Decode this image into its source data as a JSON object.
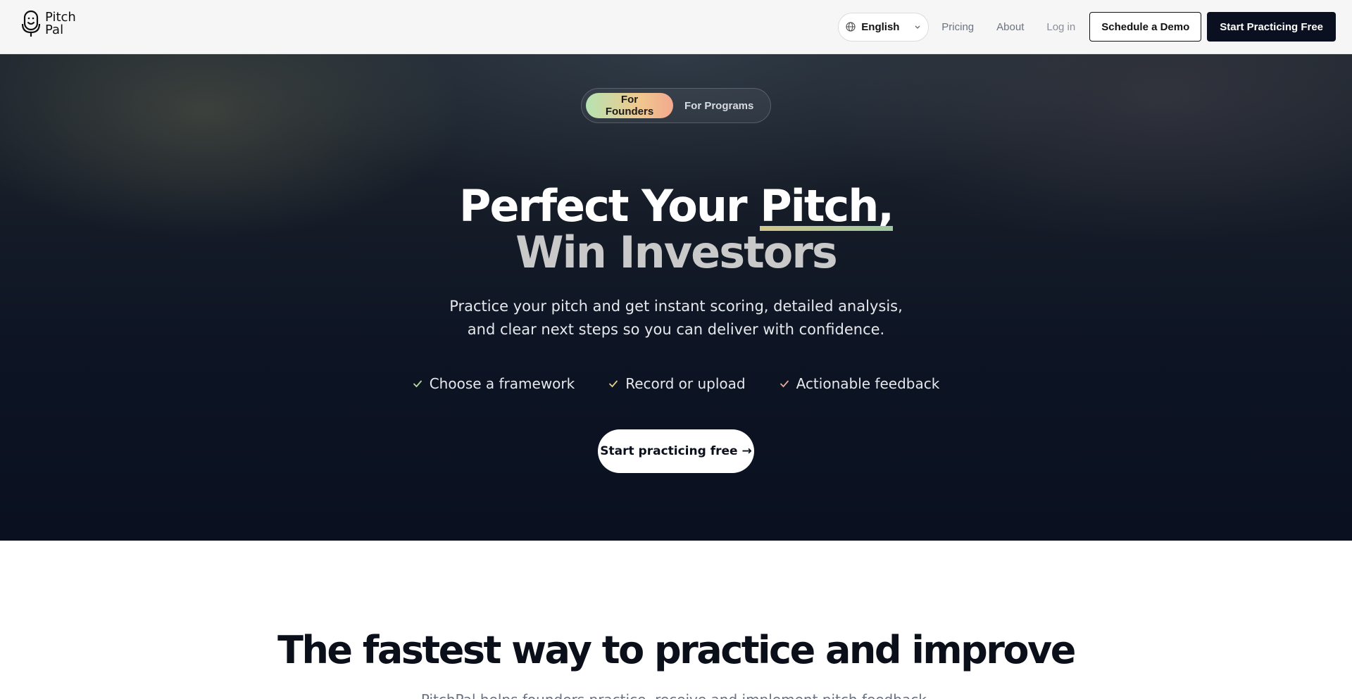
{
  "brand": {
    "name_line1": "Pitch",
    "name_line2": "Pal"
  },
  "nav": {
    "language": "English",
    "pricing": "Pricing",
    "about": "About",
    "login": "Log in",
    "demo": "Schedule a Demo",
    "start": "Start Practicing Free"
  },
  "hero": {
    "toggle": {
      "founders": "For Founders",
      "programs": "For Programs",
      "selected": "For Founders"
    },
    "headline_line1_part1": "Perfect Your ",
    "headline_line1_part2": "Pitch,",
    "headline_line2": "Win Investors",
    "subtitle_line1": "Practice your pitch and get instant scoring, detailed analysis,",
    "subtitle_line2": "and clear next steps so you can deliver with confidence.",
    "checks": [
      "Choose a framework",
      "Record or upload",
      "Actionable feedback"
    ],
    "cta": "Start practicing free →"
  },
  "section": {
    "title": "The fastest way to practice and improve",
    "subtitle": "PitchPal helps founders practice, receive and implement pitch feedback."
  },
  "colors": {
    "accent_gradient": [
      "#b6e3b2",
      "#f0c98e",
      "#f2a98e"
    ],
    "hero_bg": "#0d1424",
    "dark_button": "#0b1020"
  }
}
